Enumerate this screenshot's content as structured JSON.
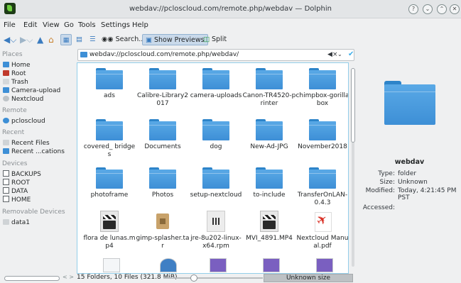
{
  "window": {
    "title": "webdav://pcloscloud.com/remote.php/webdav — Dolphin",
    "controls": [
      "?",
      "⌄",
      "⌃",
      "✕"
    ]
  },
  "menubar": [
    "File",
    "Edit",
    "View",
    "Go",
    "Tools",
    "Settings",
    "Help"
  ],
  "toolbar": {
    "search_label": "Search...",
    "previews_label": "Show Previews",
    "split_label": "Split"
  },
  "places": {
    "header": "Places",
    "items": [
      "Home",
      "Root",
      "Trash",
      "Camera-upload",
      "Nextcloud"
    ],
    "remote_header": "Remote",
    "remote_items": [
      "pcloscloud"
    ],
    "recent_header": "Recent",
    "recent_items": [
      "Recent Files",
      "Recent ...cations"
    ],
    "devices_header": "Devices",
    "devices_items": [
      "BACKUPS",
      "ROOT",
      "DATA",
      "HOME"
    ],
    "removable_header": "Removable Devices",
    "removable_items": [
      "data1"
    ]
  },
  "location": {
    "path": "webdav://pcloscloud.com/remote.php/webdav/"
  },
  "files": [
    {
      "name": "ads",
      "kind": "folder"
    },
    {
      "name": "Calibre-Library2017",
      "kind": "folder"
    },
    {
      "name": "camera-uploads",
      "kind": "folder"
    },
    {
      "name": "Canon-TR4520-printer",
      "kind": "folder"
    },
    {
      "name": "chimpbox-gorillabox",
      "kind": "folder"
    },
    {
      "name": "covered_ bridges",
      "kind": "folder"
    },
    {
      "name": "Documents",
      "kind": "folder"
    },
    {
      "name": "dog",
      "kind": "folder"
    },
    {
      "name": "New-Ad-JPG",
      "kind": "folder"
    },
    {
      "name": "November2018",
      "kind": "folder"
    },
    {
      "name": "photoframe",
      "kind": "folder"
    },
    {
      "name": "Photos",
      "kind": "folder"
    },
    {
      "name": "setup-nextcloud",
      "kind": "folder"
    },
    {
      "name": "to-include",
      "kind": "folder"
    },
    {
      "name": "TransferOnLAN-0.4.3",
      "kind": "folder"
    },
    {
      "name": "flora de lunas.mp4",
      "kind": "video"
    },
    {
      "name": "gimp-splasher.tar",
      "kind": "archive"
    },
    {
      "name": "jre-8u202-linux-x64.rpm",
      "kind": "rpm"
    },
    {
      "name": "MVI_4891.MP4",
      "kind": "video"
    },
    {
      "name": "Nextcloud Manual.pdf",
      "kind": "pdf"
    }
  ],
  "info_panel": {
    "title": "webdav",
    "type_label": "Type:",
    "type_value": "folder",
    "size_label": "Size:",
    "size_value": "Unknown",
    "modified_label": "Modified:",
    "modified_value": "Today, 4:21:45 PM PST",
    "accessed_label": "Accessed:",
    "accessed_value": ""
  },
  "status": {
    "summary": "15 Folders, 10 Files (321.8 MiB)",
    "free_space": "Unknown size",
    "hscroll_arrows": "< >"
  }
}
